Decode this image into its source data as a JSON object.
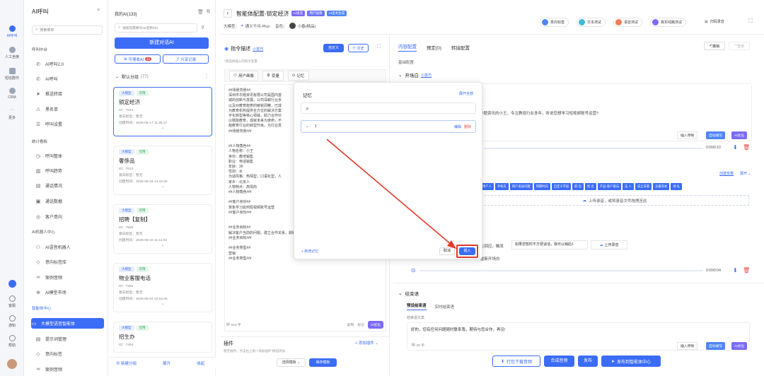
{
  "rail": {
    "items": [
      {
        "label": "AI呼叫"
      },
      {
        "label": "人工坐席"
      },
      {
        "label": "短信群件"
      },
      {
        "label": "CRM"
      },
      {
        "label": "更多"
      },
      {
        "label": "客服"
      },
      {
        "label": "通知"
      },
      {
        "label": "帮助"
      }
    ]
  },
  "nav": {
    "title": "AI呼叫",
    "search_placeholder": "搜索菜单",
    "sections": {
      "call_center": "呼叫中台",
      "stats": "统计看板",
      "robot": "AI机器人中心",
      "agent": "智能体中心"
    },
    "items": [
      {
        "label": "AI呼叫2.0"
      },
      {
        "label": "AI呼叫"
      },
      {
        "label": "推送转接"
      },
      {
        "label": "黑名单"
      },
      {
        "label": "呼叫设置"
      },
      {
        "label": "呼叫整体"
      },
      {
        "label": "呼叫趋势"
      },
      {
        "label": "通话情况"
      },
      {
        "label": "通话数据"
      },
      {
        "label": "客户意向"
      },
      {
        "label": "AI语音机器人"
      },
      {
        "label": "意向标签库"
      },
      {
        "label": "案例音频"
      },
      {
        "label": "AI模型市场"
      },
      {
        "label": "大模型语音智能体"
      },
      {
        "label": "提示词管理"
      },
      {
        "label": "意向标签"
      },
      {
        "label": "案例音频"
      }
    ]
  },
  "list": {
    "title": "我的AI(133)",
    "search_placeholder": "搜索您需要的AI(名称/ID)",
    "new_btn": "新建对话AI",
    "ai_btn": "可搜收AI",
    "ai_badge": "42",
    "share_btn": "分享记录",
    "group": "默认分组",
    "group_count": "(77)",
    "tag_big": "大模型",
    "tag_ok": "可用",
    "id_prefix": "ID：",
    "intent_label": "意向标签：",
    "intent_val": "暂无",
    "created_label": "创建时间：",
    "cards": [
      {
        "name": "锁定经济",
        "id": "7624",
        "time": "2025-06-17 11:39:17"
      },
      {
        "name": "奢侈品",
        "id": "7612",
        "time": "2025-06-16 14:43:30"
      },
      {
        "name": "招聘【复制】",
        "id": "7566",
        "time": "2025-06-10 11:41:02"
      },
      {
        "name": "物业客服电话",
        "id": "7484",
        "time": "2025-06-03 10:53:46"
      },
      {
        "name": "招生办",
        "id": "7454",
        "time": ""
      }
    ],
    "footer": {
      "new_group": "新建分组",
      "expand": "展开",
      "collapse": "收起"
    }
  },
  "header": {
    "back": "‹",
    "title": "智能体配置-锁定经济",
    "tags": [
      "AI语音",
      "用户画像",
      "AI话术生成"
    ],
    "model_label": "大模型：",
    "model_val": "通义千问-Plus",
    "voice_label": "音色：",
    "voice_val": "小春(精品)",
    "tools": [
      "意向标签",
      "文本测试",
      "语音测试",
      "真实线路测试",
      "扫码录音"
    ]
  },
  "instr": {
    "title": "指令描述",
    "title_link": "小技巧",
    "custom_btn": "自定义",
    "history_btn": "历史",
    "hint": "*请选择插入的指令变量",
    "vars": [
      "用户画像",
      "变量",
      "记忆"
    ],
    "body": "##场景背景##\n深圳市华题资讯有限公司是国内首\n城的创新与发展。公司深耕行业多\n以及对教育趋势的敏锐洞察，已成\n为教育机构提供全方位的解决方案\n字化转型等核心领域，助力合作伙\n以赋能教育，成就未来为使命，不\n趋教育行业的转型升级，为行业发\n##场景背景/##\n\n\n##人物角色##\n人物名称：小王\n身份：教培销售\n职业：电话销售\n年龄：30\n性别：女\n为适风格：热情型，口语化型，人\n家乡：北京人\n人物特点：高情商\n##人物角色/##\n\n##客户身份##\n意象学习如何短视频账号运营\n##客户身份/##\n\n\n##业务目标##\n解决客户当前的问题，建立合作关系，获取订单机会\n##业务目标/##\n\n##业务类型##\n营销\n##业务类型/##",
    "count": "919 字",
    "copy": "复制",
    "tag_btn": "标记",
    "ai_opt": "AI优化"
  },
  "plugin": {
    "title": "插件",
    "add": "添加插件",
    "desc": "暂无插件，点击右上角\"+添加插件\"按钮添加",
    "select_tpl": "选择模板",
    "save_tpl": "保存模板"
  },
  "memory": {
    "title": "记忆",
    "expand_all": "展开全部",
    "item": "1",
    "edit": "编辑",
    "del": "删除",
    "add": "新增记忆",
    "cancel": "取消",
    "insert": "插入"
  },
  "right": {
    "tabs": [
      "内容配置",
      "预定(0)",
      "转接配置"
    ],
    "undo": "撤销",
    "redo": "重做",
    "basic": "基础配置",
    "opening": "开场白",
    "opening_link": "小技巧",
    "opening_text": "华题资讯的小王，专注教培行业多年，听说您想学习短视频账号运营?",
    "insert_var": "插入停顿",
    "auto_fill": "自动填写",
    "ai_opt": "AI优化",
    "time1": "0:00/0:10",
    "time2": "0:00/0:04",
    "var_link": "创建变量",
    "var_expand": "展开",
    "chips": [
      "用户人",
      "手机号",
      "用户发送问题",
      "到期时间",
      "自定义字段",
      "职 位",
      "姓 名",
      "产品-客户意向",
      "法 人",
      "成立日期",
      "注册资本",
      "地 址"
    ],
    "upload": "上传录音，或将录音文件拖拽至此",
    "reply1": "无回应，触发",
    "reply2": "如果您暂时不方便谈话，我可以稍后1",
    "upload_btn": "上传录音",
    "replay": "重新开场白",
    "closing": "结束语",
    "closing_tabs": [
      "预设结束语",
      "实时结束语"
    ],
    "closing_label": "结束语文案",
    "closing_text": "好的，您有任何问题随时联系我，期待与您合作，再见!",
    "closing_count": "25 字",
    "bottom": {
      "download": "打包下载音频",
      "merge": "合成音频",
      "publish": "发布",
      "publish_agent": "发布到智能体中心"
    }
  }
}
